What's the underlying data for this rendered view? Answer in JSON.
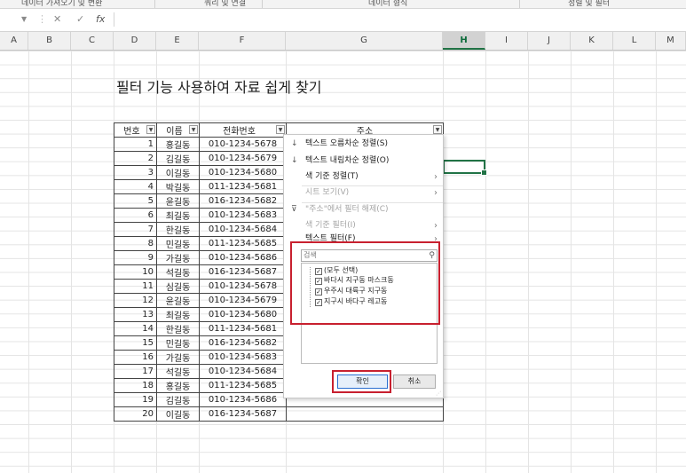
{
  "ribbon": {
    "groups": [
      "데이터 가져오기 및 변환",
      "쿼리 및 연결",
      "데이터 형식",
      "정렬 및 필터"
    ]
  },
  "formula_bar": {
    "cancel_icon": "x-icon",
    "enter_icon": "check-icon",
    "fx_label": "fx",
    "value": ""
  },
  "columns": [
    "A",
    "B",
    "C",
    "D",
    "E",
    "F",
    "G",
    "H",
    "I",
    "J",
    "K",
    "L",
    "M"
  ],
  "selected_column": "H",
  "sheet_title": "필터 기능 사용하여 자료 쉽게 찾기",
  "table": {
    "headers": [
      "번호",
      "이름",
      "전화번호",
      "주소"
    ],
    "rows": [
      {
        "no": "1",
        "name": "홍길동",
        "phone": "010-1234-5678"
      },
      {
        "no": "2",
        "name": "김길동",
        "phone": "010-1234-5679"
      },
      {
        "no": "3",
        "name": "이길동",
        "phone": "010-1234-5680"
      },
      {
        "no": "4",
        "name": "박길동",
        "phone": "011-1234-5681"
      },
      {
        "no": "5",
        "name": "윤길동",
        "phone": "016-1234-5682"
      },
      {
        "no": "6",
        "name": "최길동",
        "phone": "010-1234-5683"
      },
      {
        "no": "7",
        "name": "한길동",
        "phone": "010-1234-5684"
      },
      {
        "no": "8",
        "name": "민길동",
        "phone": "011-1234-5685"
      },
      {
        "no": "9",
        "name": "가길동",
        "phone": "010-1234-5686"
      },
      {
        "no": "10",
        "name": "석길동",
        "phone": "016-1234-5687"
      },
      {
        "no": "11",
        "name": "심길동",
        "phone": "010-1234-5678"
      },
      {
        "no": "12",
        "name": "윤길동",
        "phone": "010-1234-5679"
      },
      {
        "no": "13",
        "name": "최길동",
        "phone": "010-1234-5680"
      },
      {
        "no": "14",
        "name": "한길동",
        "phone": "011-1234-5681"
      },
      {
        "no": "15",
        "name": "민길동",
        "phone": "016-1234-5682"
      },
      {
        "no": "16",
        "name": "가길동",
        "phone": "010-1234-5683"
      },
      {
        "no": "17",
        "name": "석길동",
        "phone": "010-1234-5684"
      },
      {
        "no": "18",
        "name": "홍길동",
        "phone": "011-1234-5685"
      },
      {
        "no": "19",
        "name": "김길동",
        "phone": "010-1234-5686"
      },
      {
        "no": "20",
        "name": "이길동",
        "phone": "016-1234-5687"
      }
    ]
  },
  "filter_menu": {
    "sort_asc": "텍스트 오름차순 정렬(S)",
    "sort_desc": "텍스트 내림차순 정렬(O)",
    "sort_by_color": "색 기준 정렬(T)",
    "sheet_view": "시트 보기(V)",
    "clear_filter": "\"주소\"에서 필터 해제(C)",
    "filter_by_color": "색 기준 필터(I)",
    "text_filter": "텍스트 필터(F)",
    "search_placeholder": "검색",
    "items": [
      {
        "label": "(모두 선택)",
        "checked": true
      },
      {
        "label": "바다시 지구동 마스크동",
        "checked": true
      },
      {
        "label": "우주시 대륙구 지구동",
        "checked": true
      },
      {
        "label": "지구시 바다구 레고동",
        "checked": true
      }
    ],
    "ok_label": "확인",
    "cancel_label": "취소"
  },
  "highlight_color": "#c8202f",
  "accent_color": "#217346"
}
